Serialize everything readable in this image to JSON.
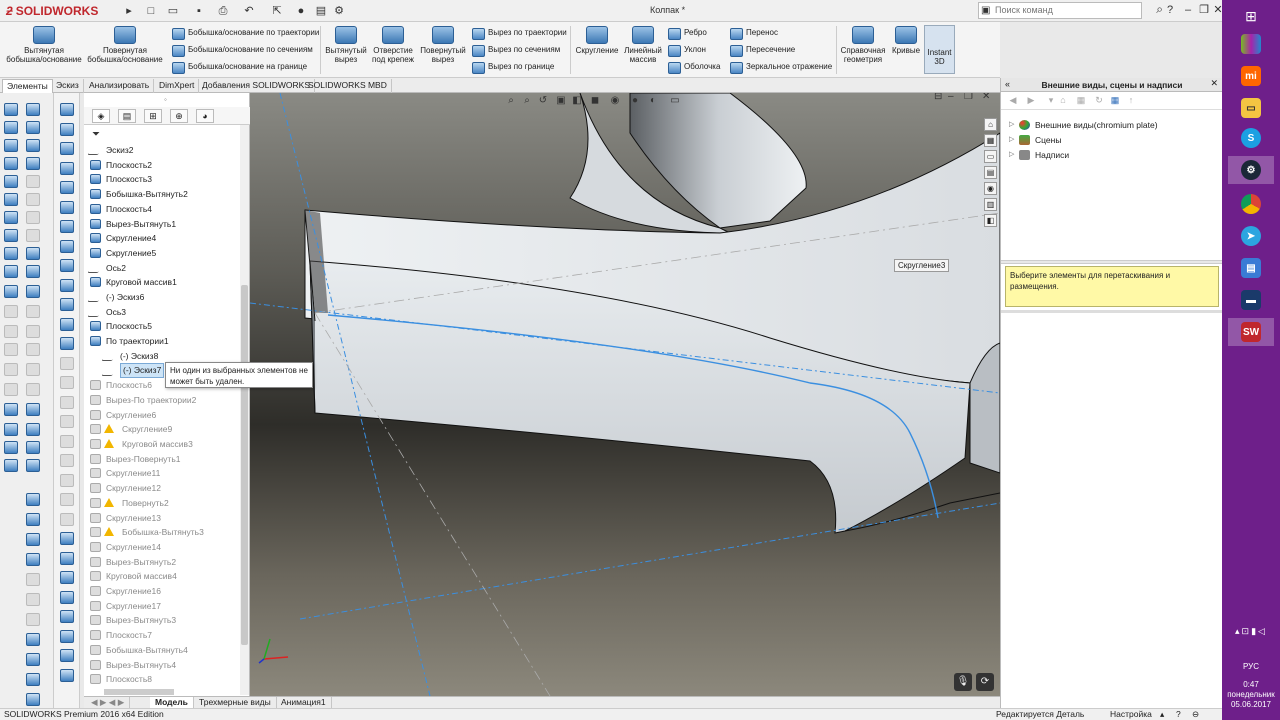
{
  "app": {
    "logo": "SOLIDWORKS",
    "doc_title": "Колпак *"
  },
  "search": {
    "placeholder": "Поиск команд"
  },
  "ribbon": {
    "big": [
      "Вытянутая бобышка/основание",
      "Повернутая бобышка/основание",
      "Вытянутый вырез",
      "Отверстие под крепеж",
      "Повернутый вырез",
      "Скругление",
      "Линейный массив",
      "Справочная геометрия",
      "Кривые",
      "Instant 3D"
    ],
    "small": [
      "Бобышка/основание по траектории",
      "Бобышка/основание по сечениям",
      "Бобышка/основание на границе",
      "Вырез по траектории",
      "Вырез по сечениям",
      "Вырез по границе",
      "Ребро",
      "Уклон",
      "Оболочка",
      "Перенос",
      "Пересечение",
      "Зеркальное отражение"
    ]
  },
  "tabs": [
    "Элементы",
    "Эскиз",
    "Анализировать",
    "DimXpert",
    "Добавления SOLIDWORKS",
    "SOLIDWORKS MBD"
  ],
  "tree": {
    "items": [
      {
        "label": "Эскиз2",
        "state": "normal",
        "icon": "sketch"
      },
      {
        "label": "Плоскость2",
        "state": "normal",
        "icon": "plane"
      },
      {
        "label": "Плоскость3",
        "state": "normal",
        "icon": "plane"
      },
      {
        "label": "Бобышка-Вытянуть2",
        "state": "normal",
        "icon": "feature"
      },
      {
        "label": "Плоскость4",
        "state": "normal",
        "icon": "plane"
      },
      {
        "label": "Вырез-Вытянуть1",
        "state": "normal",
        "icon": "feature"
      },
      {
        "label": "Скругление4",
        "state": "normal",
        "icon": "feature"
      },
      {
        "label": "Скругление5",
        "state": "normal",
        "icon": "feature"
      },
      {
        "label": "Ось2",
        "state": "normal",
        "icon": "axis"
      },
      {
        "label": "Круговой массив1",
        "state": "normal",
        "icon": "feature"
      },
      {
        "label": "(-) Эскиз6",
        "state": "normal",
        "icon": "sketch"
      },
      {
        "label": "Ось3",
        "state": "normal",
        "icon": "axis"
      },
      {
        "label": "Плоскость5",
        "state": "normal",
        "icon": "plane"
      },
      {
        "label": "По траектории1",
        "state": "normal",
        "icon": "feature"
      },
      {
        "label": "(-) Эскиз8",
        "state": "child",
        "icon": "sketch"
      },
      {
        "label": "(-) Эскиз7",
        "state": "selected",
        "icon": "sketch"
      },
      {
        "label": "Плоскость6",
        "state": "grey",
        "icon": "plane"
      },
      {
        "label": "Вырез-По траектории2",
        "state": "grey",
        "icon": "feature"
      },
      {
        "label": "Скругление6",
        "state": "grey",
        "icon": "feature"
      },
      {
        "label": "Скругление9",
        "state": "warn",
        "icon": "feature"
      },
      {
        "label": "Круговой массив3",
        "state": "warn",
        "icon": "feature"
      },
      {
        "label": "Вырез-Повернуть1",
        "state": "grey",
        "icon": "feature"
      },
      {
        "label": "Скругление11",
        "state": "grey",
        "icon": "feature"
      },
      {
        "label": "Скругление12",
        "state": "grey",
        "icon": "feature"
      },
      {
        "label": "Повернуть2",
        "state": "warn",
        "icon": "feature"
      },
      {
        "label": "Скругление13",
        "state": "grey",
        "icon": "feature"
      },
      {
        "label": "Бобышка-Вытянуть3",
        "state": "warn",
        "icon": "feature"
      },
      {
        "label": "Скругление14",
        "state": "grey",
        "icon": "feature"
      },
      {
        "label": "Вырез-Вытянуть2",
        "state": "grey",
        "icon": "feature"
      },
      {
        "label": "Круговой массив4",
        "state": "grey",
        "icon": "feature"
      },
      {
        "label": "Скругление16",
        "state": "grey",
        "icon": "feature"
      },
      {
        "label": "Скругление17",
        "state": "grey",
        "icon": "feature"
      },
      {
        "label": "Вырез-Вытянуть3",
        "state": "grey",
        "icon": "feature"
      },
      {
        "label": "Плоскость7",
        "state": "grey",
        "icon": "plane"
      },
      {
        "label": "Бобышка-Вытянуть4",
        "state": "grey",
        "icon": "feature"
      },
      {
        "label": "Вырез-Вытянуть4",
        "state": "grey",
        "icon": "feature"
      },
      {
        "label": "Плоскость8",
        "state": "grey",
        "icon": "plane"
      }
    ],
    "tooltip": "Ни один из выбранных элементов не может быть удален."
  },
  "viewport": {
    "tooltip": "Скругление3"
  },
  "bottom_tabs": [
    "Модель",
    "Трехмерные виды",
    "Анимация1"
  ],
  "taskpane": {
    "title": "Внешние виды, сцены и надписи",
    "items": [
      "Внешние виды(chromium plate)",
      "Сцены",
      "Надписи"
    ],
    "message": "Выберите элементы для перетаскивания и размещения."
  },
  "status": {
    "left": "SOLIDWORKS Premium 2016 x64 Edition",
    "mode": "Редактируется Деталь",
    "settings": "Настройка"
  },
  "system": {
    "lang": "РУС",
    "time": "0:47",
    "day": "понедельник",
    "date": "05.06.2017"
  }
}
